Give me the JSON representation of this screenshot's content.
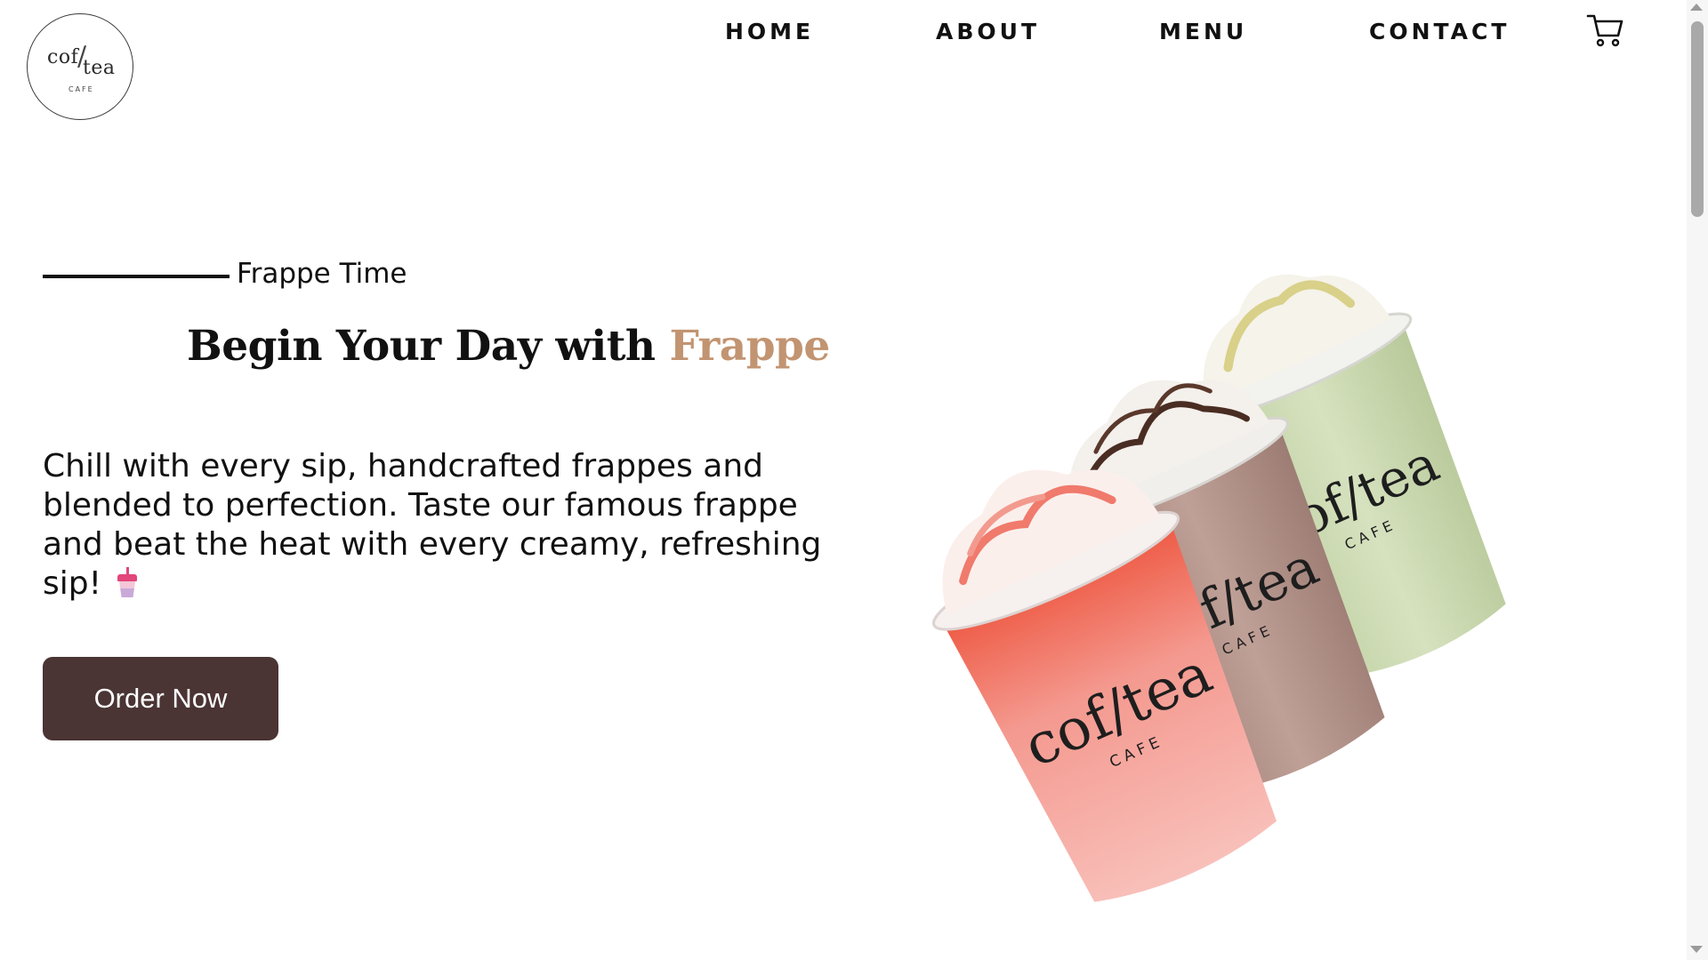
{
  "logo": {
    "line1": "cof",
    "slash": "/",
    "line2": "tea",
    "subtitle": "CAFE"
  },
  "nav": {
    "home": "HOME",
    "about": "ABOUT",
    "menu": "MENU",
    "contact": "CONTACT"
  },
  "hero": {
    "eyebrow": "Frappe Time",
    "headline_prefix": "Begin Your Day with ",
    "headline_accent": "Frappe",
    "description": "Chill with every sip, handcrafted frappes and blended to perfection. Taste our famous frappe and beat the heat with every creamy, refreshing sip!",
    "button": "Order Now",
    "cup_brand_1": "cof/tea",
    "cup_brand_2": "CAFE"
  },
  "colors": {
    "accent": "#c29471",
    "button_bg": "#4a3434",
    "strawberry": "#f4a9a6",
    "chocolate": "#b4938b",
    "matcha": "#cfdcb4"
  },
  "icons": {
    "cart": "cart-icon",
    "cup": "cup-with-straw-emoji"
  }
}
